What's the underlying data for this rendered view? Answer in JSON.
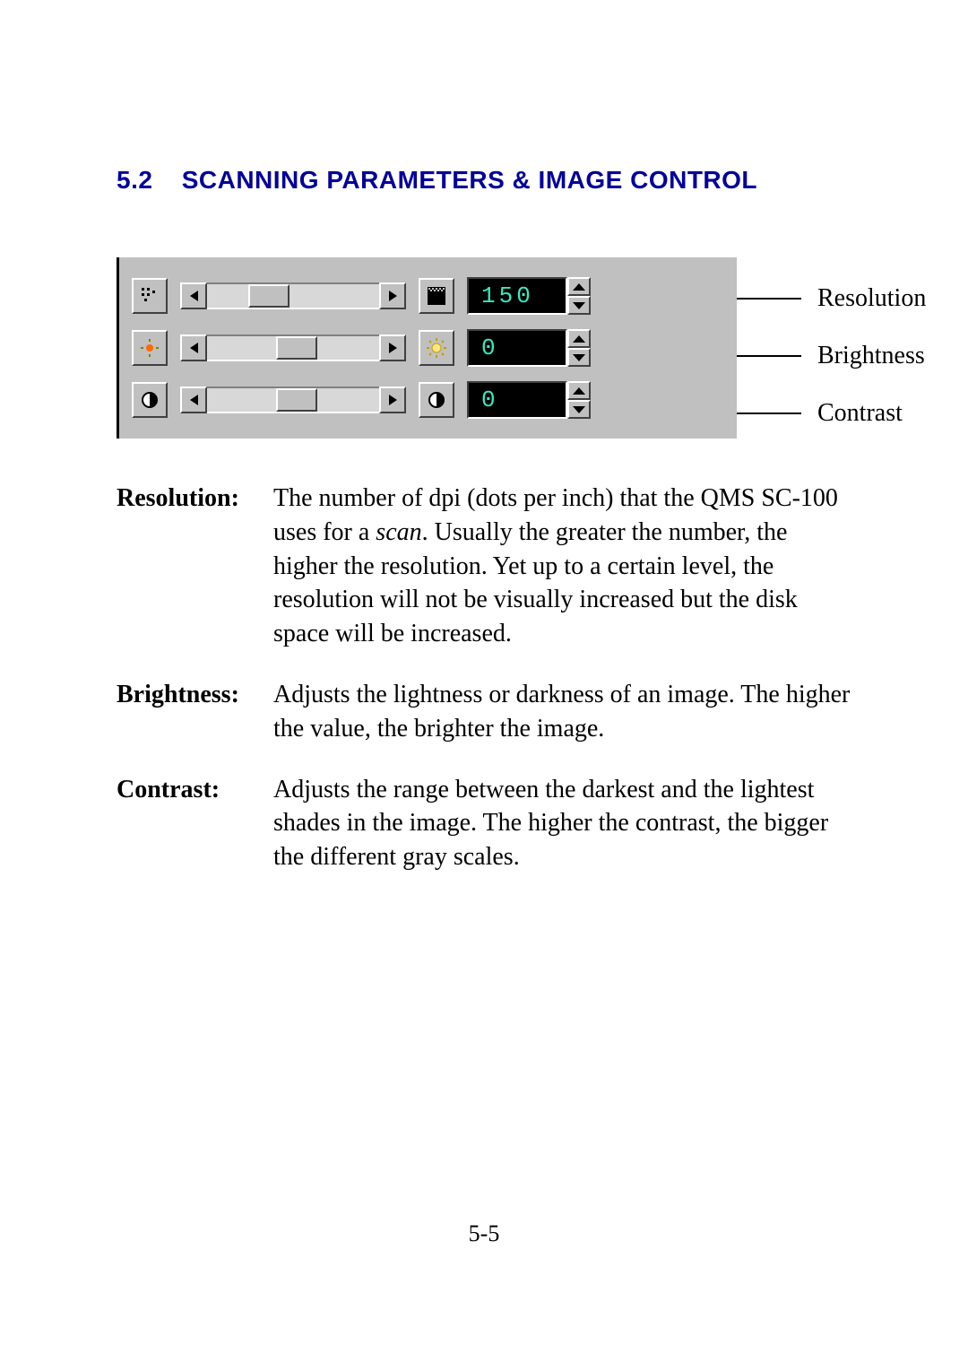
{
  "heading": {
    "number": "5.2",
    "title": "SCANNING PARAMETERS & IMAGE CONTROL"
  },
  "panel": {
    "rows": [
      {
        "id": "resolution",
        "value": "150",
        "thumb_pct": 24,
        "callout": "Resolution"
      },
      {
        "id": "brightness",
        "value": "0",
        "thumb_pct": 40,
        "callout": "Brightness"
      },
      {
        "id": "contrast",
        "value": "0",
        "thumb_pct": 40,
        "callout": "Contrast"
      }
    ]
  },
  "definitions": [
    {
      "term": "Resolution:",
      "text_before": "The number of dpi (dots per inch) that the QMS SC-100 uses for a ",
      "italic": "scan",
      "text_after": ". Usually the greater the number, the higher the resolution.  Yet up to a certain level, the resolution will not be visually increased but the disk space will be increased."
    },
    {
      "term": "Brightness:",
      "text_before": "Adjusts the lightness or darkness of an image. The higher the value, the brighter the image.",
      "italic": "",
      "text_after": ""
    },
    {
      "term": "Contrast:",
      "text_before": "Adjusts the range between the darkest and the lightest shades in the image.  The higher the contrast, the bigger the different gray scales.",
      "italic": "",
      "text_after": ""
    }
  ],
  "page_number": "5-5"
}
